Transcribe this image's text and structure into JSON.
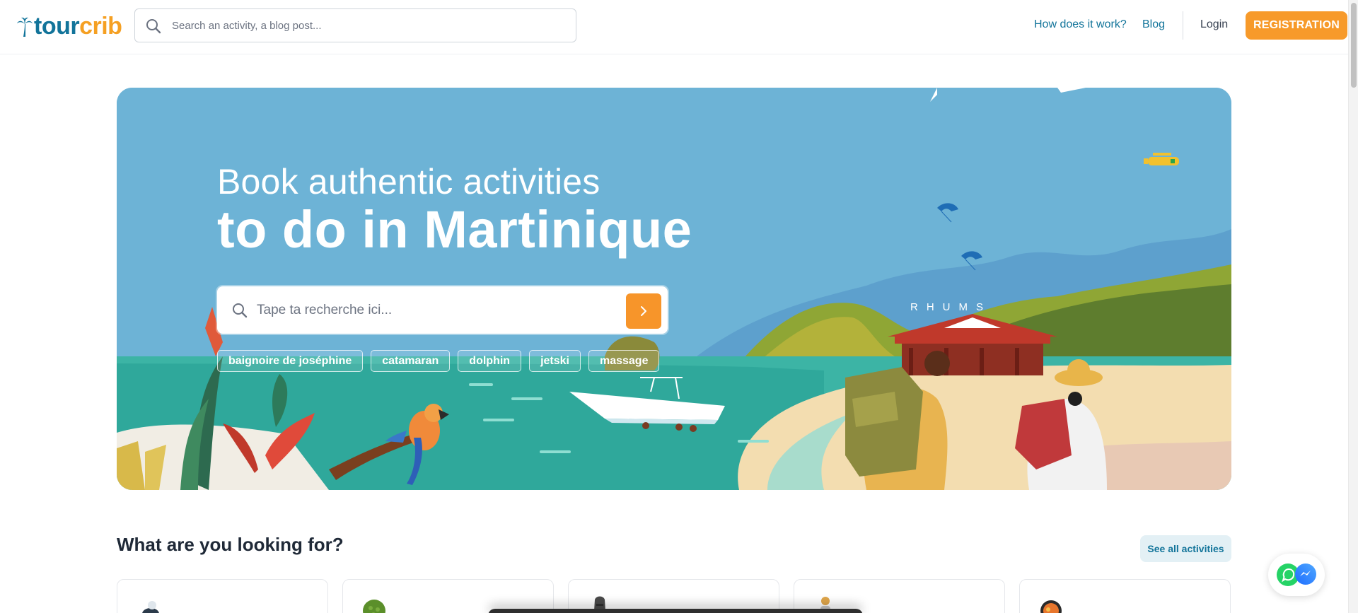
{
  "header": {
    "logo_part1": "tour",
    "logo_part2": "crib",
    "search_placeholder": "Search an activity, a blog post...",
    "nav": {
      "how": "How does it work?",
      "blog": "Blog",
      "login": "Login",
      "registration": "REGISTRATION"
    }
  },
  "hero": {
    "title_light": "Book authentic activities",
    "title_bold": "to do in Martinique",
    "search_placeholder": "Tape ta recherche ici...",
    "tags": [
      "baignoire de joséphine",
      "catamaran",
      "dolphin",
      "jetski",
      "massage"
    ],
    "sign_letters": "RHUMS"
  },
  "section": {
    "title": "What are you looking for?",
    "see_all": "See all activities"
  },
  "icons": {
    "search": "search-icon",
    "go": "chevron-right-icon",
    "whatsapp": "whatsapp-icon",
    "messenger": "messenger-icon"
  },
  "colors": {
    "brand_blue": "#12749a",
    "brand_orange": "#f5a023",
    "cta_orange": "#f79a2a",
    "hero_sky": "#6db3d6"
  }
}
